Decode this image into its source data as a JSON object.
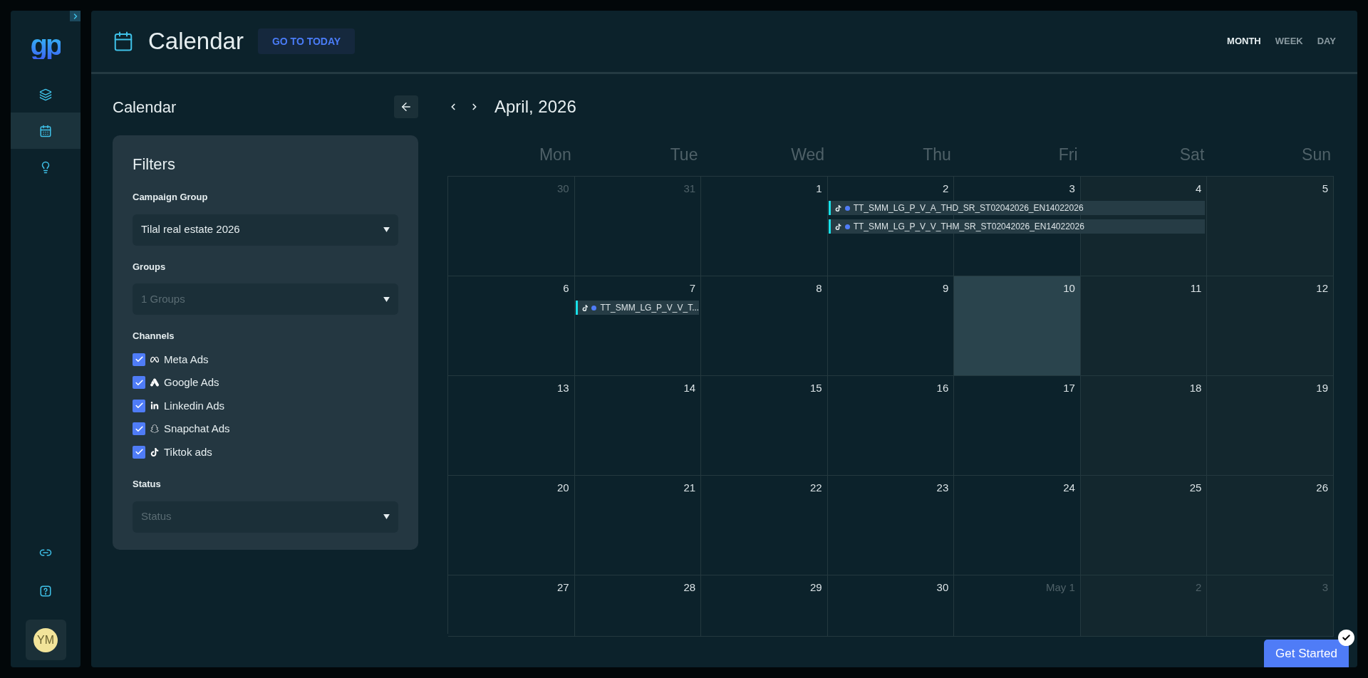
{
  "sidebar": {
    "logo": "gp",
    "nav_items": [
      {
        "kind": "layers",
        "selected": false
      },
      {
        "kind": "calendar",
        "selected": true
      },
      {
        "kind": "bulb",
        "selected": false
      }
    ],
    "bottom_items": [
      {
        "kind": "link"
      },
      {
        "kind": "help"
      }
    ],
    "avatar": "YM"
  },
  "header": {
    "title": "Calendar",
    "today_button": "GO TO TODAY",
    "views": [
      {
        "label": "MONTH",
        "selected": true
      },
      {
        "label": "WEEK",
        "selected": false
      },
      {
        "label": "DAY",
        "selected": false
      }
    ]
  },
  "filters_panel": {
    "title": "Calendar",
    "card_title": "Filters",
    "campaign_group": {
      "label": "Campaign Group",
      "value": "Tilal real estate 2026"
    },
    "groups": {
      "label": "Groups",
      "placeholder": "1 Groups"
    },
    "channels": {
      "label": "Channels",
      "items": [
        {
          "kind": "meta",
          "label": "Meta Ads",
          "checked": true
        },
        {
          "kind": "google",
          "label": "Google Ads",
          "checked": true
        },
        {
          "kind": "linkedin",
          "label": "Linkedin Ads",
          "checked": true
        },
        {
          "kind": "snapchat",
          "label": "Snapchat Ads",
          "checked": true
        },
        {
          "kind": "tiktok",
          "label": "Tiktok ads",
          "checked": true
        }
      ]
    },
    "status": {
      "label": "Status",
      "placeholder": "Status"
    }
  },
  "calendar": {
    "month": "April, 2026",
    "weekdays": [
      "Mon",
      "Tue",
      "Wed",
      "Thu",
      "Fri",
      "Sat",
      "Sun"
    ],
    "weeks": [
      {
        "days": [
          {
            "label": "30",
            "outside": true,
            "today": false
          },
          {
            "label": "31",
            "outside": true,
            "today": false
          },
          {
            "label": "1",
            "outside": false,
            "today": false
          },
          {
            "label": "2",
            "outside": false,
            "today": false,
            "events": [
              {
                "kind": "tiktok",
                "title": "TT_SMM_LG_P_V_A_THD_SR_ST02042026_EN14022026"
              },
              {
                "kind": "tiktok",
                "title": "TT_SMM_LG_P_V_V_THM_SR_ST02042026_EN14022026"
              }
            ]
          },
          {
            "label": "3",
            "outside": false,
            "today": false,
            "events": [
              {
                "kind": "continuation"
              },
              {
                "kind": "continuation"
              }
            ]
          },
          {
            "label": "4",
            "outside": false,
            "today": false,
            "events": [
              {
                "kind": "continuation"
              },
              {
                "kind": "continuation"
              }
            ]
          },
          {
            "label": "5",
            "outside": false,
            "today": false
          }
        ]
      },
      {
        "days": [
          {
            "label": "6",
            "outside": false,
            "today": false
          },
          {
            "label": "7",
            "outside": false,
            "today": false,
            "events": [
              {
                "kind": "tiktok",
                "title": "TT_SMM_LG_P_V_V_T..."
              }
            ]
          },
          {
            "label": "8",
            "outside": false,
            "today": false
          },
          {
            "label": "9",
            "outside": false,
            "today": false
          },
          {
            "label": "10",
            "outside": false,
            "today": true
          },
          {
            "label": "11",
            "outside": false,
            "today": false
          },
          {
            "label": "12",
            "outside": false,
            "today": false
          }
        ]
      },
      {
        "days": [
          {
            "label": "13",
            "outside": false,
            "today": false
          },
          {
            "label": "14",
            "outside": false,
            "today": false
          },
          {
            "label": "15",
            "outside": false,
            "today": false
          },
          {
            "label": "16",
            "outside": false,
            "today": false
          },
          {
            "label": "17",
            "outside": false,
            "today": false
          },
          {
            "label": "18",
            "outside": false,
            "today": false
          },
          {
            "label": "19",
            "outside": false,
            "today": false
          }
        ]
      },
      {
        "days": [
          {
            "label": "20",
            "outside": false,
            "today": false
          },
          {
            "label": "21",
            "outside": false,
            "today": false
          },
          {
            "label": "22",
            "outside": false,
            "today": false
          },
          {
            "label": "23",
            "outside": false,
            "today": false
          },
          {
            "label": "24",
            "outside": false,
            "today": false
          },
          {
            "label": "25",
            "outside": false,
            "today": false
          },
          {
            "label": "26",
            "outside": false,
            "today": false
          }
        ]
      },
      {
        "days": [
          {
            "label": "27",
            "outside": false,
            "today": false
          },
          {
            "label": "28",
            "outside": false,
            "today": false
          },
          {
            "label": "29",
            "outside": false,
            "today": false
          },
          {
            "label": "30",
            "outside": false,
            "today": false
          },
          {
            "label": "May 1",
            "outside": true,
            "today": false
          },
          {
            "label": "2",
            "outside": true,
            "today": false
          },
          {
            "label": "3",
            "outside": true,
            "today": false
          }
        ]
      }
    ]
  },
  "get_started": {
    "label": "Get Started",
    "done": true
  }
}
